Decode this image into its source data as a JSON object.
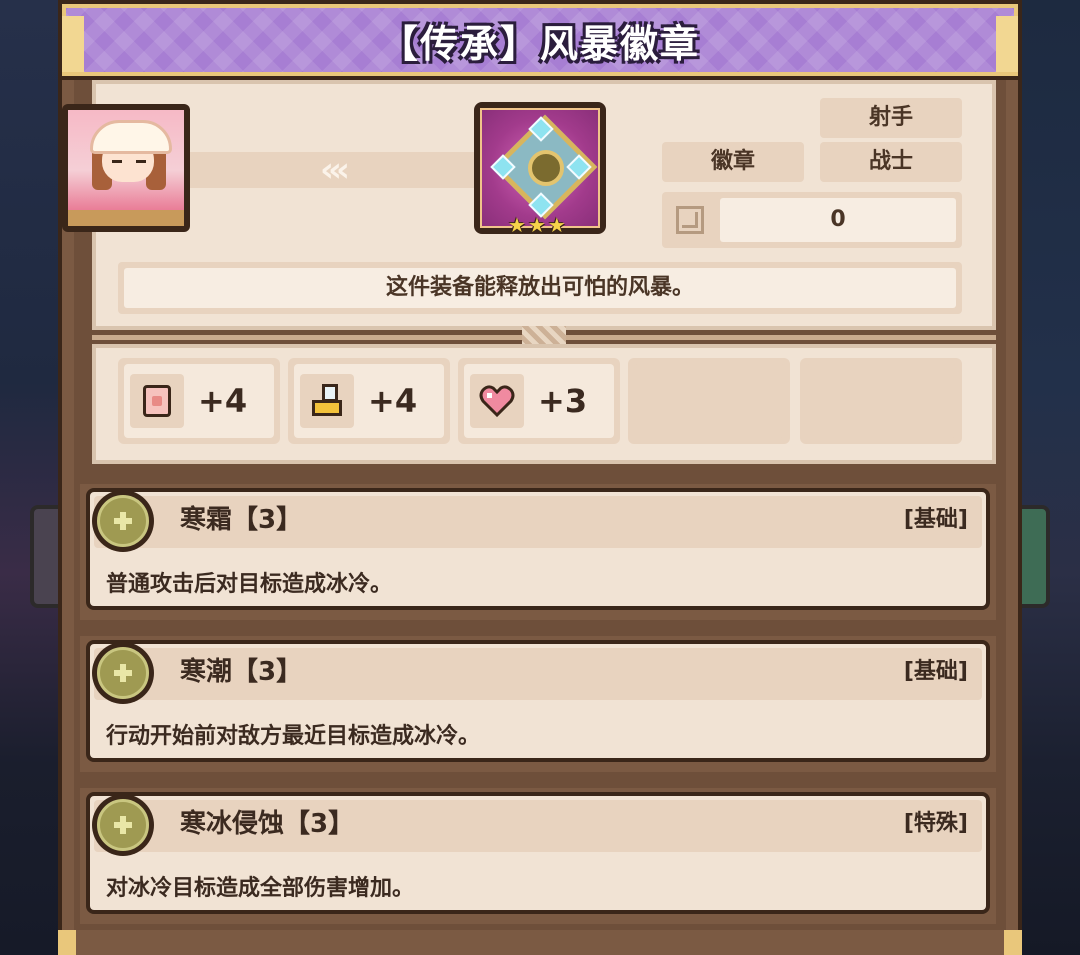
{
  "title": "【传承】风暴徽章",
  "item": {
    "arrows": "‹‹‹",
    "stars": [
      "★",
      "★",
      "★"
    ],
    "tags": {
      "shooter": "射手",
      "badge": "徽章",
      "warrior": "战士"
    },
    "count": "0",
    "description": "这件装备能释放出可怕的风暴。"
  },
  "stats": [
    {
      "icon": "fist-icon",
      "value": "+4"
    },
    {
      "icon": "boot-icon",
      "value": "+4"
    },
    {
      "icon": "heart-icon",
      "value": "+3"
    }
  ],
  "skills": [
    {
      "name": "寒霜【3】",
      "type": "[基础]",
      "desc": "普通攻击后对目标造成冰冷。"
    },
    {
      "name": "寒潮【3】",
      "type": "[基础]",
      "desc": "行动开始前对敌方最近目标造成冰冷。"
    },
    {
      "name": "寒冰侵蚀【3】",
      "type": "[特殊]",
      "desc": "对冰冷目标造成全部伤害增加。"
    }
  ],
  "colors": {
    "title_purple": "#a77ed3",
    "frame_brown": "#7b5a43",
    "card_cream": "#f1e3d4",
    "text_dark": "#3b2a20"
  }
}
